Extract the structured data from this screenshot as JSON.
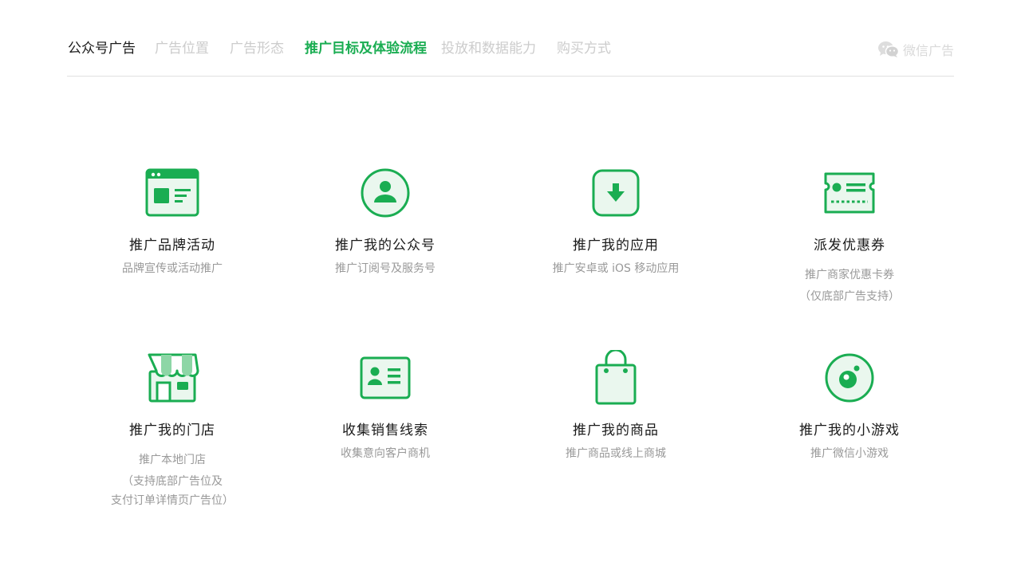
{
  "nav": {
    "brand": "公众号广告",
    "items": [
      {
        "label": "广告位置",
        "active": false
      },
      {
        "label": "广告形态",
        "active": false
      },
      {
        "label": "推广目标及体验流程",
        "active": true
      },
      {
        "label": "投放和数据能力",
        "active": false
      },
      {
        "label": "购买方式",
        "active": false
      }
    ],
    "logo_text": "微信广告"
  },
  "colors": {
    "accent": "#1aad52",
    "icon_fill": "#eaf7ee",
    "text": "#1a1a1a",
    "muted": "#999999",
    "nav_inactive": "#cccccc"
  },
  "cards": [
    {
      "icon": "browser-icon",
      "title": "推广品牌活动",
      "desc": [
        "品牌宣传或活动推广"
      ]
    },
    {
      "icon": "user-avatar-icon",
      "title": "推广我的公众号",
      "desc": [
        "推广订阅号及服务号"
      ]
    },
    {
      "icon": "download-app-icon",
      "title": "推广我的应用",
      "desc": [
        "推广安卓或 iOS 移动应用"
      ]
    },
    {
      "icon": "coupon-ticket-icon",
      "title": "派发优惠券",
      "desc": [
        "推广商家优惠卡券",
        "（仅底部广告支持）"
      ]
    },
    {
      "icon": "storefront-icon",
      "title": "推广我的门店",
      "desc": [
        "推广本地门店",
        "（支持底部广告位及",
        "支付订单详情页广告位）"
      ]
    },
    {
      "icon": "contact-card-icon",
      "title": "收集销售线索",
      "desc": [
        "收集意向客户商机"
      ]
    },
    {
      "icon": "shopping-bag-icon",
      "title": "推广我的商品",
      "desc": [
        "推广商品或线上商城"
      ]
    },
    {
      "icon": "mini-game-icon",
      "title": "推广我的小游戏",
      "desc": [
        "推广微信小游戏"
      ]
    }
  ]
}
